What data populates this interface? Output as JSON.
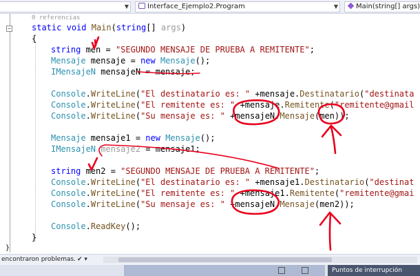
{
  "nav": {
    "project_dropdown": "",
    "class_dropdown": "Interface_Ejemplo2.Program",
    "member_dropdown": "Main(string[] args)"
  },
  "editor": {
    "references": "0 referencias",
    "lines": [
      "static void Main(string[] args)",
      "{",
      "string men = \"SEGUNDO MENSAJE DE PRUEBA A REMITENTE\";",
      "Mensaje mensaje = new Mensaje();",
      "IMensajeN mensajeN = mensaje;",
      "Console.WriteLine(\"El destinatario es: \" +mensaje.Destinatario(\"destinata",
      "Console.WriteLine(\"El remitente es: \" +mensaje.Remitente(\"remitente@gmail",
      "Console.WriteLine(\"Su mensaje es: \" +mensajeN.Mensaje(men));",
      "Mensaje mensaje1 = new Mensaje();",
      "IMensajeN mensaje2 = mensaje1;",
      "string men2 = \"SEGUNDO MENSAJE DE PRUEBA A REMITENTE\";",
      "Console.WriteLine(\"El destinatario es: \" +mensaje1.Destinatario(\"destinat",
      "Console.WriteLine(\"El remitente es: \" +mensaje1.Remitente(\"remitente@gmai",
      "Console.WriteLine(\"Su mensaje es: \" +mensajeN.Mensaje(men2));",
      "Console.ReadKey();",
      "}"
    ]
  },
  "status": {
    "message": "encontraron problemas.",
    "control": "✔ ▾"
  },
  "bottom": {
    "tab": "Puntos de interrupción"
  },
  "colors": {
    "keyword": "#0000ff",
    "type": "#2b91af",
    "string": "#a31515",
    "method": "#74531f",
    "annotation": "#e8001c"
  }
}
